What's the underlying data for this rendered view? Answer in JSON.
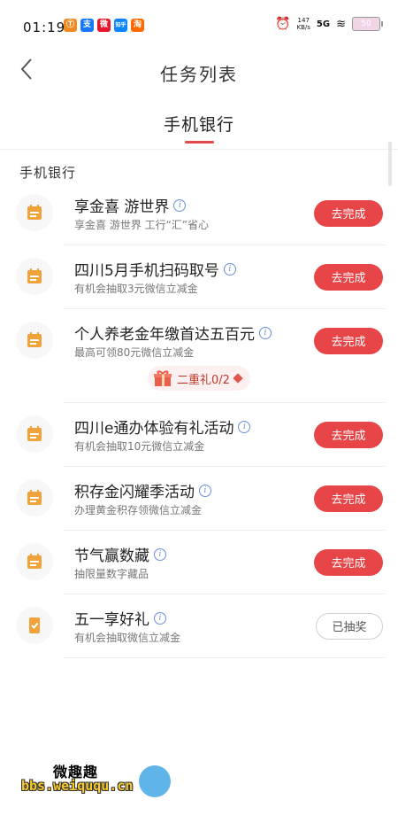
{
  "status": {
    "time": "01:19",
    "app_icons": [
      {
        "label": "Ⓣ",
        "color": "#f08a24"
      },
      {
        "label": "支",
        "color": "#1677ff"
      },
      {
        "label": "微",
        "color": "#e6162d"
      },
      {
        "label": "知乎",
        "color": "#0a84ff"
      },
      {
        "label": "淘",
        "color": "#ff6a00"
      }
    ],
    "net_speed_value": "147",
    "net_speed_unit": "KB/s",
    "signal": "5G",
    "battery": "50"
  },
  "header": {
    "title": "任务列表",
    "back_icon": "chevron-left-icon"
  },
  "tabs": [
    {
      "label": "手机银行",
      "active": true
    }
  ],
  "section_title": "手机银行",
  "tasks": [
    {
      "name": "享金喜 游世界",
      "desc": "享金喜 游世界 工行“汇”省心",
      "button": "去完成",
      "done": false,
      "icon": "calendar-icon"
    },
    {
      "name": "四川5月手机扫码取号",
      "desc": "有机会抽取3元微信立减金",
      "button": "去完成",
      "done": false,
      "icon": "calendar-icon"
    },
    {
      "name": "个人养老金年缴首达五百元",
      "desc": "最高可领80元微信立减金",
      "button": "去完成",
      "done": false,
      "icon": "calendar-icon"
    },
    {
      "name": "四川e通办体验有礼活动",
      "desc": "有机会抽取10元微信立减金",
      "button": "去完成",
      "done": false,
      "icon": "calendar-icon"
    },
    {
      "name": "积存金闪耀季活动",
      "desc": "办理黄金积存领微信立减金",
      "button": "去完成",
      "done": false,
      "icon": "calendar-icon"
    },
    {
      "name": "节气赢数藏",
      "desc": "抽限量数字藏品",
      "button": "去完成",
      "done": false,
      "icon": "calendar-icon"
    },
    {
      "name": "五一享好礼",
      "desc": "有机会抽取微信立减金",
      "button": "已抽奖",
      "done": true,
      "icon": "phone-check-icon"
    }
  ],
  "gift": {
    "label": "二重礼0/2",
    "icon": "gift-icon"
  },
  "watermark": {
    "top": "微趣趣",
    "url": "bbs.weiququ.cn"
  },
  "colors": {
    "accent": "#e84548",
    "icon_orange": "#f0a33b",
    "info_blue": "#6a8fd8"
  }
}
